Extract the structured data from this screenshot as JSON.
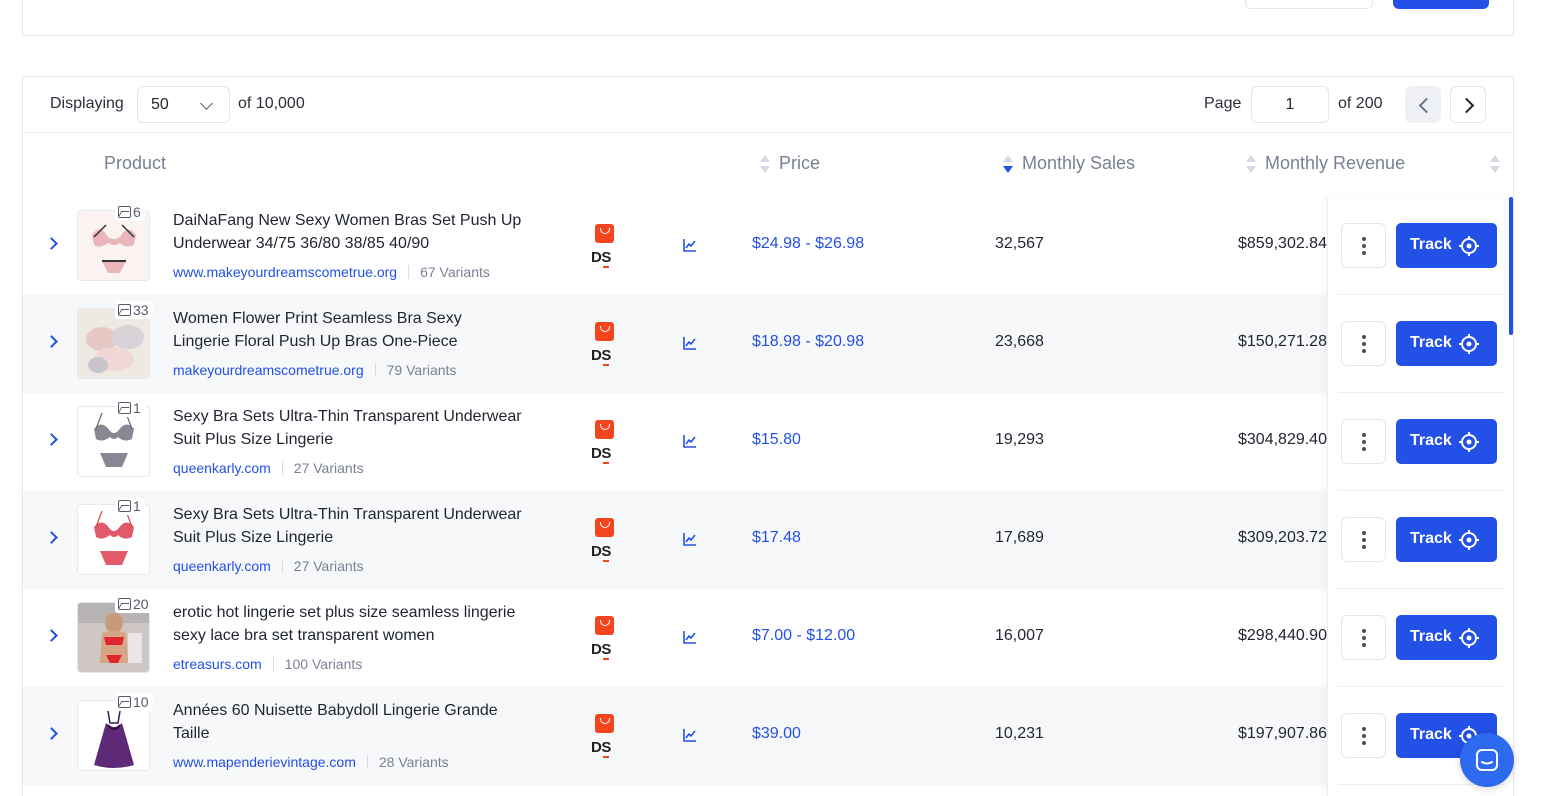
{
  "toolbar": {
    "displaying_label": "Displaying",
    "page_size": "50",
    "of_total": "of 10,000",
    "page_label": "Page",
    "page_number": "1",
    "of_pages": "of 200"
  },
  "columns": {
    "product": "Product",
    "price": "Price",
    "monthly_sales": "Monthly Sales",
    "monthly_revenue": "Monthly Revenue"
  },
  "actions": {
    "track_label": "Track"
  },
  "rows": [
    {
      "image_count": "6",
      "title": "DaiNaFang New Sexy Women Bras Set Push Up Underwear 34/75 36/80 38/85 40/90",
      "store": "www.makeyourdreamscometrue.org",
      "variants": "67 Variants",
      "price": "$24.98 - $26.98",
      "sales": "32,567",
      "revenue": "$859,302.84"
    },
    {
      "image_count": "33",
      "title": "Women Flower Print Seamless Bra Sexy Lingerie Floral Push Up Bras One-Piece",
      "store": "makeyourdreamscometrue.org",
      "variants": "79 Variants",
      "price": "$18.98 - $20.98",
      "sales": "23,668",
      "revenue": "$150,271.28"
    },
    {
      "image_count": "1",
      "title": "Sexy Bra Sets Ultra-Thin Transparent Underwear Suit Plus Size Lingerie",
      "store": "queenkarly.com",
      "variants": "27 Variants",
      "price": "$15.80",
      "sales": "19,293",
      "revenue": "$304,829.40"
    },
    {
      "image_count": "1",
      "title": "Sexy Bra Sets Ultra-Thin Transparent Underwear Suit Plus Size Lingerie",
      "store": "queenkarly.com",
      "variants": "27 Variants",
      "price": "$17.48",
      "sales": "17,689",
      "revenue": "$309,203.72"
    },
    {
      "image_count": "20",
      "title": "erotic hot lingerie set plus size seamless lingerie sexy lace bra set transparent women",
      "store": "etreasurs.com",
      "variants": "100 Variants",
      "price": "$7.00 - $12.00",
      "sales": "16,007",
      "revenue": "$298,440.90"
    },
    {
      "image_count": "10",
      "title": "Années 60 Nuisette Babydoll Lingerie Grande Taille",
      "store": "www.mapenderievintage.com",
      "variants": "28 Variants",
      "price": "$39.00",
      "sales": "10,231",
      "revenue": "$197,907.86"
    }
  ],
  "colors": {
    "accent": "#2350e6",
    "aliexpress": "#f4451e",
    "row_alt": "#f7f8fa"
  },
  "icons": [
    "chevron-right-icon",
    "image-icon",
    "aliexpress-icon",
    "trend-chart-icon",
    "more-vertical-icon",
    "crosshair-icon",
    "chat-icon"
  ]
}
